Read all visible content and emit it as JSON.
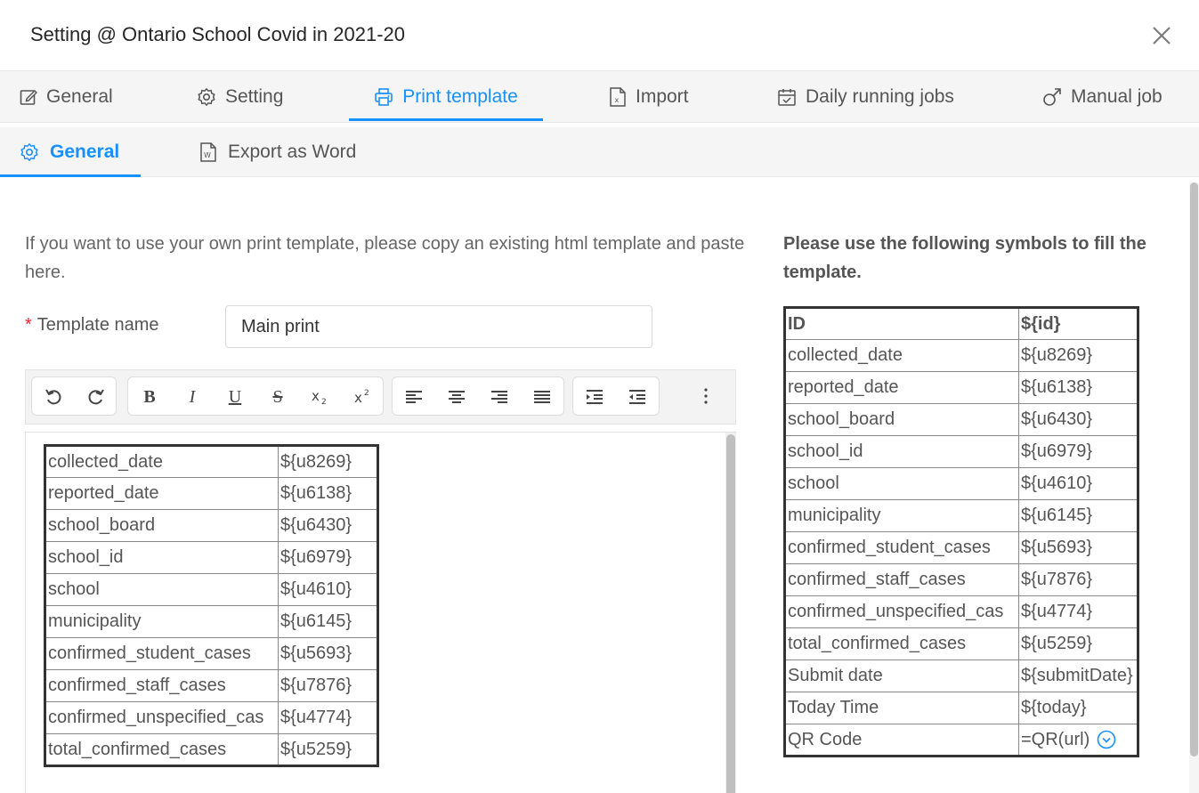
{
  "dialog": {
    "title": "Setting @ Ontario School Covid in 2021-20"
  },
  "tabs": [
    {
      "label": "General",
      "icon": "edit-icon"
    },
    {
      "label": "Setting",
      "icon": "gear-icon"
    },
    {
      "label": "Print template",
      "icon": "printer-icon"
    },
    {
      "label": "Import",
      "icon": "excel-file-icon"
    },
    {
      "label": "Daily running jobs",
      "icon": "calendar-icon"
    },
    {
      "label": "Manual job",
      "icon": "male-icon"
    }
  ],
  "active_tab": "Print template",
  "subtabs": [
    {
      "label": "General",
      "icon": "gear-icon"
    },
    {
      "label": "Export as Word",
      "icon": "word-file-icon"
    }
  ],
  "active_subtab": "General",
  "intro": "If you want to use your own print template, please copy an existing html template and paste here.",
  "form": {
    "template_name_label": "Template name",
    "template_name_value": "Main print"
  },
  "toolbar": [
    "undo-icon",
    "redo-icon",
    "bold-icon",
    "italic-icon",
    "underline-icon",
    "strikethrough-icon",
    "subscript-icon",
    "superscript-icon",
    "align-left-icon",
    "align-center-icon",
    "align-right-icon",
    "align-justify-icon",
    "indent-icon",
    "outdent-icon",
    "more-icon"
  ],
  "toolbar_glyphs": {
    "bold": "B",
    "italic": "I",
    "underline": "U",
    "strike": "S"
  },
  "editor_table": [
    [
      "collected_date",
      "${u8269}"
    ],
    [
      "reported_date",
      "${u6138}"
    ],
    [
      "school_board",
      "${u6430}"
    ],
    [
      "school_id",
      "${u6979}"
    ],
    [
      "school",
      "${u4610}"
    ],
    [
      "municipality",
      "${u6145}"
    ],
    [
      "confirmed_student_cases",
      "${u5693}"
    ],
    [
      "confirmed_staff_cases",
      "${u7876}"
    ],
    [
      "confirmed_unspecified_cas",
      "${u4774}"
    ],
    [
      "total_confirmed_cases",
      "${u5259}"
    ]
  ],
  "symbols": {
    "title": "Please use the following symbols to fill the template.",
    "header": [
      "ID",
      "${id}"
    ],
    "rows": [
      [
        "collected_date",
        "${u8269}"
      ],
      [
        "reported_date",
        "${u6138}"
      ],
      [
        "school_board",
        "${u6430}"
      ],
      [
        "school_id",
        "${u6979}"
      ],
      [
        "school",
        "${u4610}"
      ],
      [
        "municipality",
        "${u6145}"
      ],
      [
        "confirmed_student_cases",
        "${u5693}"
      ],
      [
        "confirmed_staff_cases",
        "${u7876}"
      ],
      [
        "confirmed_unspecified_cas",
        "${u4774}"
      ],
      [
        "total_confirmed_cases",
        "${u5259}"
      ],
      [
        "Submit date",
        "${submitDate}"
      ],
      [
        "Today Time",
        "${today}"
      ],
      [
        "QR Code",
        "=QR(url)"
      ]
    ]
  },
  "colors": {
    "accent": "#1890ff",
    "required": "#f5222d"
  }
}
